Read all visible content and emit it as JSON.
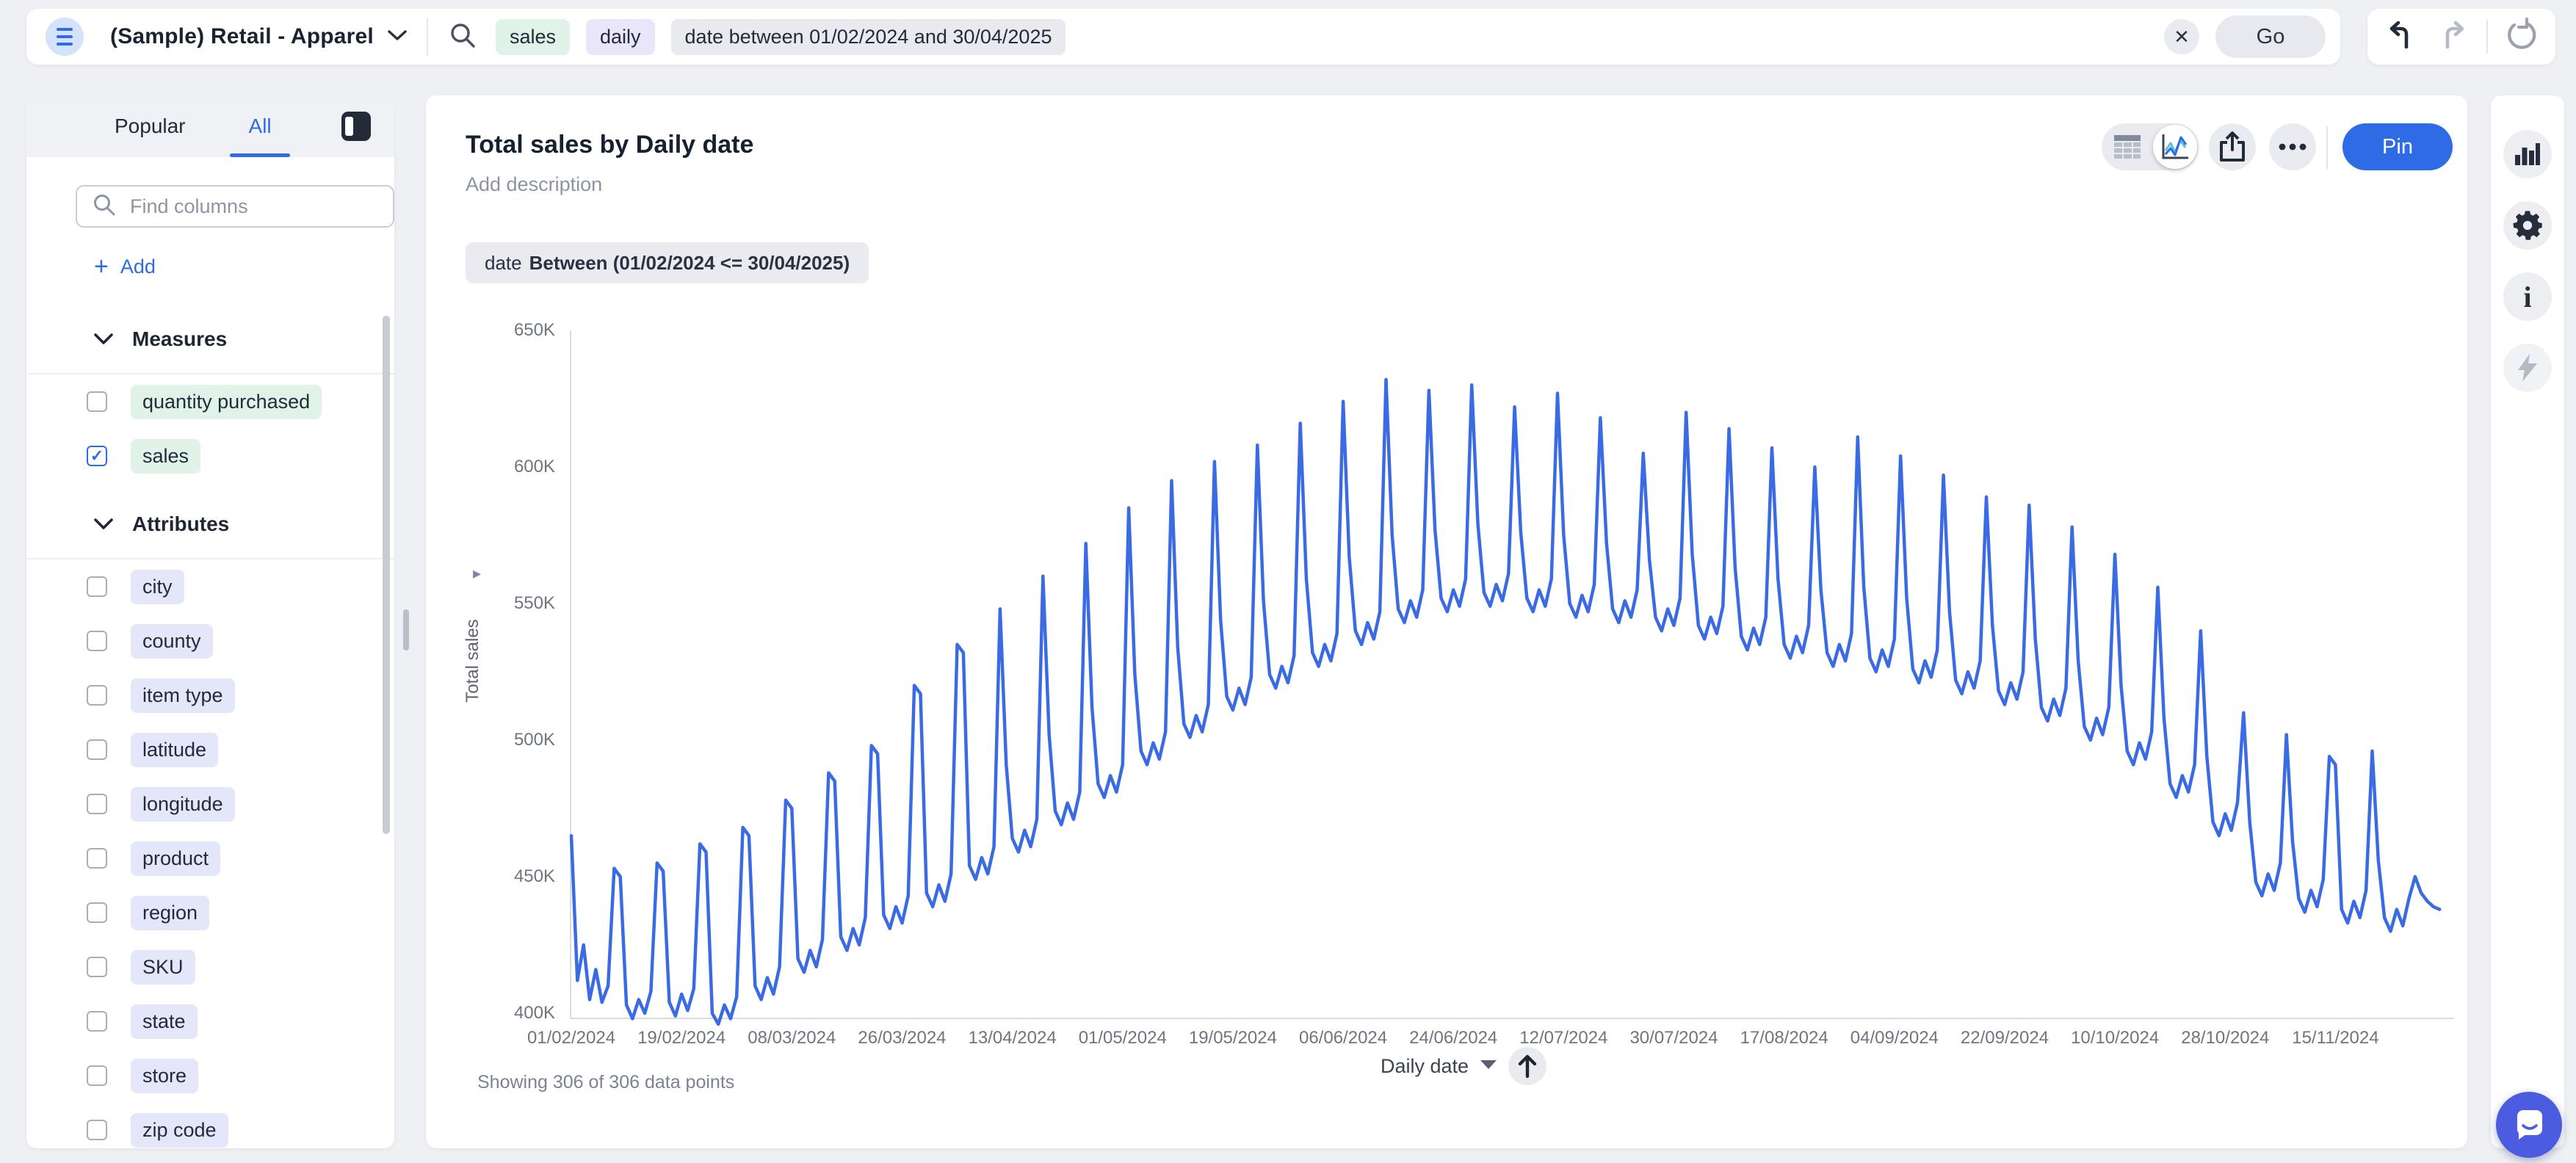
{
  "topbar": {
    "workspace": "(Sample) Retail - Apparel",
    "tokens": [
      {
        "text": "sales",
        "type": "measure"
      },
      {
        "text": "daily",
        "type": "keyword"
      },
      {
        "text": "date between 01/02/2024 and 30/04/2025",
        "type": "filter"
      }
    ],
    "clear_label": "✕",
    "go_label": "Go"
  },
  "sidebar": {
    "tabs": [
      {
        "label": "Popular",
        "active": false
      },
      {
        "label": "All",
        "active": true
      }
    ],
    "search_placeholder": "Find columns",
    "add_label": "Add",
    "sections": [
      {
        "title": "Measures",
        "items": [
          {
            "label": "quantity purchased",
            "checked": false,
            "kind": "measure"
          },
          {
            "label": "sales",
            "checked": true,
            "kind": "measure"
          }
        ]
      },
      {
        "title": "Attributes",
        "items": [
          {
            "label": "city",
            "checked": false,
            "kind": "attribute"
          },
          {
            "label": "county",
            "checked": false,
            "kind": "attribute"
          },
          {
            "label": "item type",
            "checked": false,
            "kind": "attribute"
          },
          {
            "label": "latitude",
            "checked": false,
            "kind": "attribute"
          },
          {
            "label": "longitude",
            "checked": false,
            "kind": "attribute"
          },
          {
            "label": "product",
            "checked": false,
            "kind": "attribute"
          },
          {
            "label": "region",
            "checked": false,
            "kind": "attribute"
          },
          {
            "label": "SKU",
            "checked": false,
            "kind": "attribute"
          },
          {
            "label": "state",
            "checked": false,
            "kind": "attribute"
          },
          {
            "label": "store",
            "checked": false,
            "kind": "attribute"
          },
          {
            "label": "zip code",
            "checked": false,
            "kind": "attribute"
          }
        ]
      }
    ]
  },
  "main": {
    "title": "Total sales by Daily date",
    "description_placeholder": "Add description",
    "filter_chip": {
      "prefix": "date",
      "condition": "Between (01/02/2024 <= 30/04/2025)"
    },
    "pin_label": "Pin",
    "footer": {
      "showing": "Showing 306 of 306 data points",
      "x_axis_control": "Daily date"
    }
  },
  "colors": {
    "accent_blue": "#2e6be4",
    "line_blue": "#3b6be3",
    "chat_indigo": "#4b5ce0",
    "measure_pill": "#e1f3e8",
    "attribute_pill": "#e4e7f9",
    "chip_gray": "#e9ebf0"
  },
  "chart_data": {
    "type": "line",
    "title": "Total sales by Daily date",
    "xlabel": "Daily date",
    "ylabel": "Total sales",
    "legend": [],
    "grid": false,
    "start_date": "01/02/2024",
    "interval": "daily",
    "n_points": 306,
    "unit": "thousand (K)",
    "ylim_k": [
      400,
      650
    ],
    "y_ticks": [
      "650K",
      "600K",
      "550K",
      "500K",
      "450K",
      "400K"
    ],
    "x_tick_interval_days": 18,
    "x_ticks": [
      "01/02/2024",
      "19/02/2024",
      "08/03/2024",
      "26/03/2024",
      "13/04/2024",
      "01/05/2024",
      "19/05/2024",
      "06/06/2024",
      "24/06/2024",
      "12/07/2024",
      "30/07/2024",
      "17/08/2024",
      "04/09/2024",
      "22/09/2024",
      "10/10/2024",
      "28/10/2024",
      "15/11/2024"
    ],
    "values_k": [
      465,
      412,
      425,
      405,
      416,
      404,
      410,
      453,
      450,
      403,
      398,
      405,
      400,
      408,
      455,
      452,
      404,
      399,
      407,
      401,
      409,
      462,
      459,
      400,
      396,
      403,
      398,
      406,
      468,
      465,
      410,
      405,
      413,
      407,
      417,
      478,
      475,
      420,
      415,
      423,
      417,
      427,
      488,
      485,
      428,
      423,
      431,
      425,
      435,
      498,
      495,
      436,
      431,
      439,
      433,
      443,
      520,
      517,
      444,
      439,
      447,
      441,
      451,
      535,
      532,
      454,
      449,
      457,
      451,
      461,
      548,
      491,
      464,
      459,
      467,
      461,
      471,
      560,
      502,
      474,
      469,
      477,
      471,
      481,
      572,
      512,
      484,
      479,
      487,
      481,
      491,
      585,
      524,
      496,
      491,
      499,
      493,
      503,
      595,
      534,
      506,
      501,
      509,
      503,
      513,
      602,
      544,
      516,
      511,
      519,
      513,
      523,
      608,
      551,
      524,
      519,
      527,
      521,
      531,
      616,
      559,
      532,
      527,
      535,
      529,
      539,
      624,
      567,
      540,
      535,
      543,
      537,
      547,
      632,
      575,
      548,
      543,
      551,
      545,
      555,
      628,
      577,
      552,
      547,
      555,
      549,
      559,
      630,
      579,
      554,
      549,
      557,
      551,
      561,
      622,
      576,
      552,
      547,
      555,
      549,
      559,
      627,
      575,
      550,
      545,
      553,
      547,
      557,
      618,
      572,
      548,
      543,
      551,
      545,
      555,
      605,
      566,
      545,
      540,
      548,
      542,
      552,
      620,
      568,
      542,
      537,
      545,
      539,
      549,
      614,
      563,
      538,
      533,
      541,
      535,
      545,
      607,
      559,
      535,
      530,
      538,
      532,
      542,
      600,
      555,
      532,
      527,
      535,
      529,
      539,
      611,
      556,
      530,
      525,
      533,
      527,
      537,
      604,
      552,
      526,
      521,
      529,
      523,
      533,
      597,
      547,
      522,
      517,
      525,
      519,
      529,
      589,
      542,
      518,
      513,
      521,
      515,
      525,
      586,
      537,
      512,
      507,
      515,
      509,
      519,
      578,
      529,
      505,
      500,
      508,
      502,
      512,
      568,
      520,
      496,
      491,
      499,
      493,
      503,
      556,
      508,
      484,
      479,
      487,
      481,
      491,
      540,
      494,
      470,
      465,
      473,
      467,
      477,
      510,
      470,
      448,
      443,
      451,
      445,
      455,
      502,
      463,
      442,
      437,
      445,
      439,
      449,
      494,
      491,
      438,
      433,
      441,
      435,
      445,
      496,
      456,
      435,
      430,
      438,
      432,
      442,
      450,
      444,
      441,
      439,
      438
    ],
    "line_color": "#3b6be3"
  }
}
